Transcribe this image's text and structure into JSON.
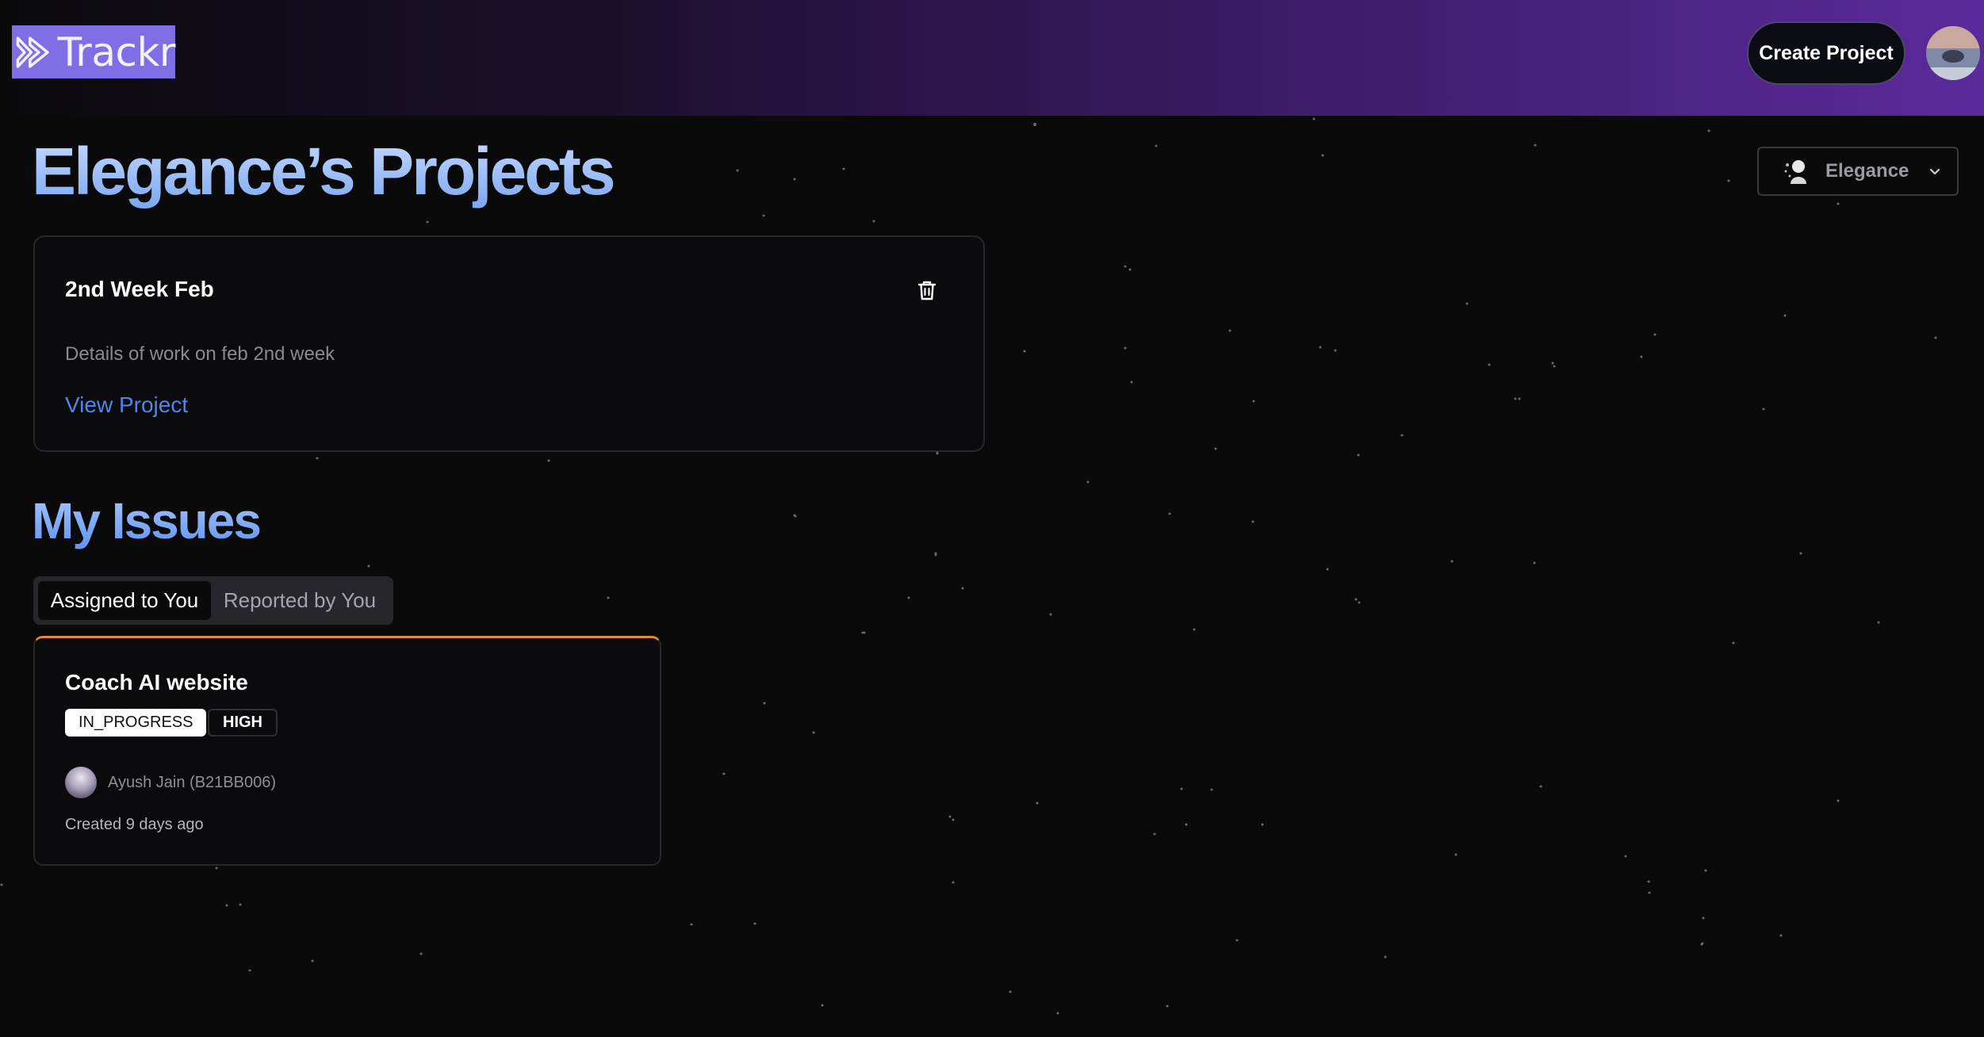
{
  "header": {
    "logo_text": "Trackr",
    "create_button": "Create Project"
  },
  "page": {
    "title": "Elegance’s Projects"
  },
  "org_switcher": {
    "name": "Elegance"
  },
  "project_card": {
    "title": "2nd Week Feb",
    "description": "Details of work on feb 2nd week",
    "link": "View Project"
  },
  "issues": {
    "section_title": "My Issues",
    "tabs": [
      {
        "label": "Assigned to You",
        "active": true
      },
      {
        "label": "Reported by You",
        "active": false
      }
    ],
    "items": [
      {
        "title": "Coach AI website",
        "status": "IN_PROGRESS",
        "priority": "HIGH",
        "assignee": "Ayush Jain (B21BB006)",
        "created": "Created 9 days ago"
      }
    ]
  },
  "colors": {
    "accent_blue": "#4f86e8",
    "issue_border_accent": "#e08a3a",
    "logo_bg": "#7f6fe6"
  }
}
